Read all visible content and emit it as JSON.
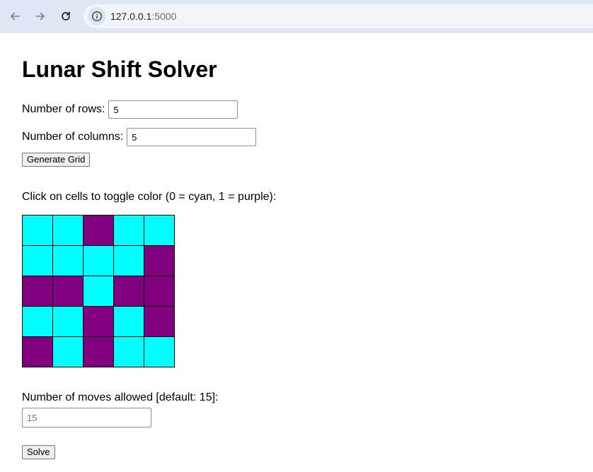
{
  "browser": {
    "back_icon": "arrow-left-icon",
    "forward_icon": "arrow-right-icon",
    "reload_icon": "reload-icon",
    "info_icon": "info-icon",
    "url_host": "127.0.0.1",
    "url_port": ":5000"
  },
  "page": {
    "title": "Lunar Shift Solver",
    "rows_label": "Number of rows:",
    "rows_value": "5",
    "columns_label": "Number of columns:",
    "columns_value": "5",
    "generate_button": "Generate Grid",
    "instruction": "Click on cells to toggle color (0 = cyan, 1 = purple):",
    "moves_label": "Number of moves allowed [default: 15]:",
    "moves_placeholder": "15",
    "solve_button": "Solve"
  },
  "colors": {
    "cell_0": "#00ffff",
    "cell_1": "#800080"
  },
  "grid": [
    [
      0,
      0,
      1,
      0,
      0
    ],
    [
      0,
      0,
      0,
      0,
      1
    ],
    [
      1,
      1,
      0,
      1,
      1
    ],
    [
      0,
      0,
      1,
      0,
      1
    ],
    [
      1,
      0,
      1,
      0,
      0
    ]
  ]
}
